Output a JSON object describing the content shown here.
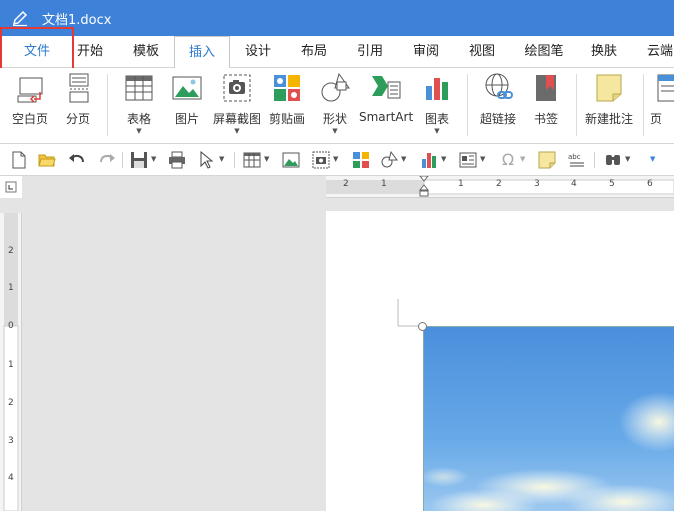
{
  "titlebar": {
    "title": "文档1.docx",
    "app_icon": "pen-icon"
  },
  "menu": {
    "file": "文件",
    "tabs": [
      "开始",
      "模板",
      "插入",
      "设计",
      "布局",
      "引用",
      "审阅",
      "视图",
      "绘图笔",
      "换肤",
      "云端"
    ],
    "active_tab": "插入",
    "accent_color": "#3d82d8",
    "highlight_color": "#e53935"
  },
  "ribbon": {
    "blank_page": "空白页",
    "page_break": "分页",
    "table": "表格",
    "picture": "图片",
    "screenshot": "屏幕截图",
    "clipart": "剪贴画",
    "shapes": "形状",
    "smartart": "SmartArt",
    "chart": "图表",
    "hyperlink": "超链接",
    "bookmark": "书签",
    "new_comment": "新建批注",
    "header_partial": "页"
  },
  "quickbar": {
    "icons": [
      "new-document-icon",
      "open-folder-icon",
      "undo-icon",
      "redo-icon",
      "save-icon",
      "print-icon",
      "select-cursor-icon",
      "table-icon",
      "picture-icon",
      "screenshot-icon",
      "clipart-icon",
      "shapes-icon",
      "chart-icon",
      "textbox-icon",
      "symbol-icon",
      "sticky-note-icon",
      "spellcheck-icon",
      "find-icon",
      "more-icon"
    ]
  },
  "ruler": {
    "h_labels": [
      "2",
      "1",
      "1",
      "2",
      "3",
      "4",
      "5",
      "6"
    ],
    "v_labels": [
      "2",
      "1",
      "0",
      "1",
      "2",
      "3",
      "4"
    ]
  }
}
